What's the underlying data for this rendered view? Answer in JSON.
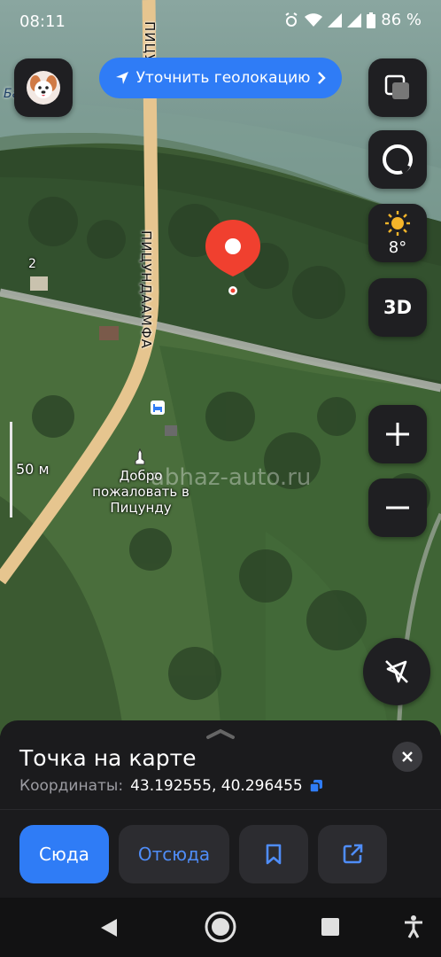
{
  "status_bar": {
    "time": "08:11",
    "battery": "86 %"
  },
  "map": {
    "street_label": "ПИЦУНДААМФА",
    "street_label_top": "ПИЦУНДС",
    "house_number": "2",
    "partial_label": "Ба",
    "poi_label": "Добро пожаловать в Пицунду",
    "scale_label": "50 м",
    "watermark": "abhaz-auto.ru"
  },
  "top_controls": {
    "geolocation_label": "Уточнить геолокацию",
    "temperature": "8°",
    "btn_3d": "3D"
  },
  "sheet": {
    "title": "Точка на карте",
    "coords_label": "Координаты:",
    "coords_value": "43.192555, 40.296455",
    "btn_here": "Сюда",
    "btn_from": "Отсюда"
  },
  "colors": {
    "accent": "#2f7cf6",
    "pin": "#f0402f",
    "sheet_bg": "#1b1b1d",
    "button_bg": "#2c2c30",
    "road": "#e6c58f"
  }
}
